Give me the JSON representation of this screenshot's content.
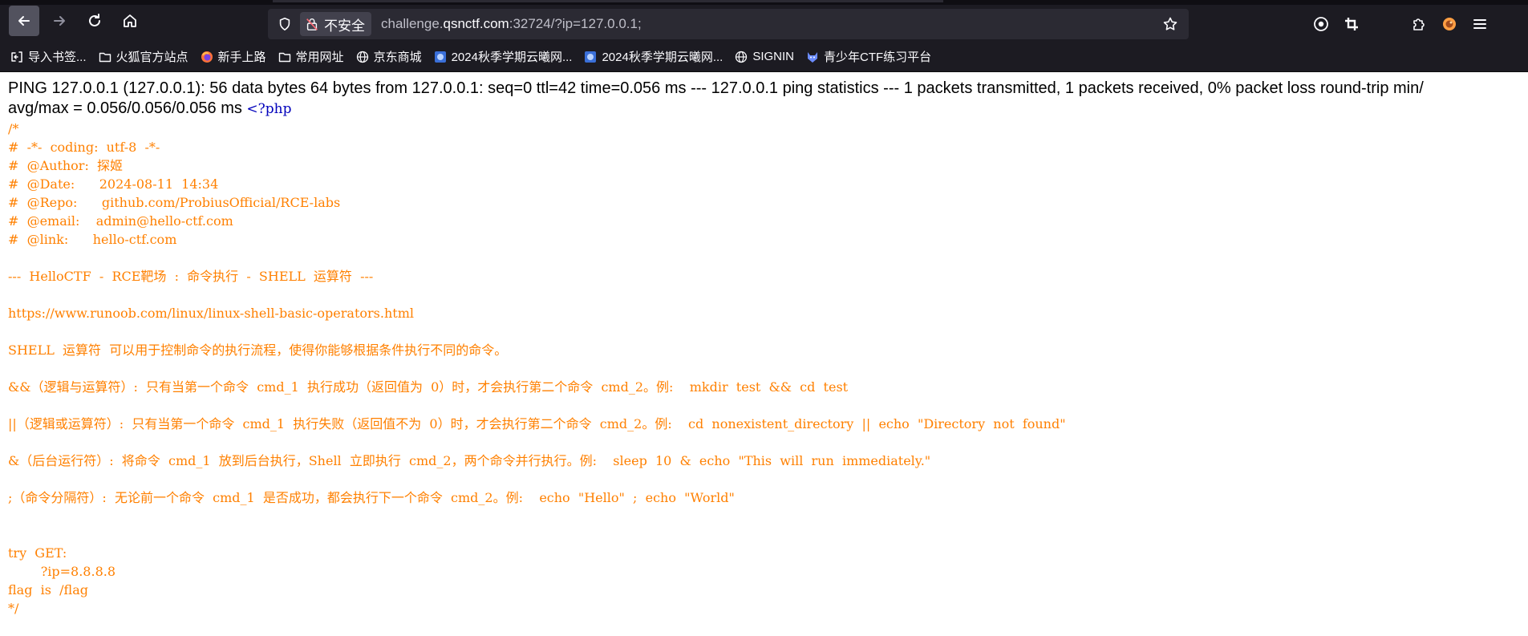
{
  "browser": {
    "insecure_label": "不安全",
    "url_host_prefix": "challenge.",
    "url_host": "qsnctf.com",
    "url_rest": ":32724/?ip=127.0.0.1;",
    "icons": {
      "back": "arrow-left-icon",
      "forward": "arrow-right-icon",
      "reload": "reload-icon",
      "home": "home-icon",
      "shield": "shield-icon",
      "lock": "insecure-lock-icon",
      "star": "star-icon",
      "account": "account-icon",
      "screenshot": "crop-icon",
      "extensions": "extensions-icon",
      "profile": "fox-icon",
      "menu": "menu-icon"
    }
  },
  "bookmarks": [
    {
      "label": "导入书签...",
      "icon": "import-icon"
    },
    {
      "label": "火狐官方站点",
      "icon": "folder-icon"
    },
    {
      "label": "新手上路",
      "icon": "firefox-icon"
    },
    {
      "label": "常用网址",
      "icon": "folder-icon"
    },
    {
      "label": "京东商城",
      "icon": "globe-icon"
    },
    {
      "label": "2024秋季学期云曦网...",
      "icon": "site-icon"
    },
    {
      "label": "2024秋季学期云曦网...",
      "icon": "site-icon"
    },
    {
      "label": "SIGNIN",
      "icon": "globe-icon"
    },
    {
      "label": "青少年CTF练习平台",
      "icon": "wolf-icon"
    }
  ],
  "page": {
    "ping_line1": "PING 127.0.0.1 (127.0.0.1): 56 data bytes 64 bytes from 127.0.0.1: seq=0 ttl=42 time=0.056 ms --- 127.0.0.1 ping statistics --- 1 packets transmitted, 1 packets received, 0% packet loss round-trip min/",
    "ping_line2": "avg/max = 0.056/0.056/0.056 ms ",
    "php_open": "<?php",
    "source": "/*\n#  -*-  coding:  utf-8  -*-\n#  @Author:  探姬\n#  @Date:      2024-08-11  14:34\n#  @Repo:      github.com/ProbiusOfficial/RCE-labs\n#  @email:    admin@hello-ctf.com\n#  @link:      hello-ctf.com\n\n---  HelloCTF  -  RCE靶场  :  命令执行  -  SHELL  运算符  ---\n\nhttps://www.runoob.com/linux/linux-shell-basic-operators.html\n\nSHELL  运算符  可以用于控制命令的执行流程，使得你能够根据条件执行不同的命令。\n\n&&（逻辑与运算符）:  只有当第一个命令  cmd_1  执行成功（返回值为  0）时，才会执行第二个命令  cmd_2。例:    mkdir  test  &&  cd  test\n\n||（逻辑或运算符）:  只有当第一个命令  cmd_1  执行失败（返回值不为  0）时，才会执行第二个命令  cmd_2。例:    cd  nonexistent_directory  ||  echo  \"Directory  not  found\"\n\n&（后台运行符）:  将命令  cmd_1  放到后台执行，Shell  立即执行  cmd_2，两个命令并行执行。例:    sleep  10  &  echo  \"This  will  run  immediately.\"\n\n;（命令分隔符）:  无论前一个命令  cmd_1  是否成功，都会执行下一个命令  cmd_2。例:    echo  \"Hello\"  ;  echo  \"World\"\n\n\ntry  GET:\n        ?ip=8.8.8.8\nflag  is  /flag\n*/"
  }
}
